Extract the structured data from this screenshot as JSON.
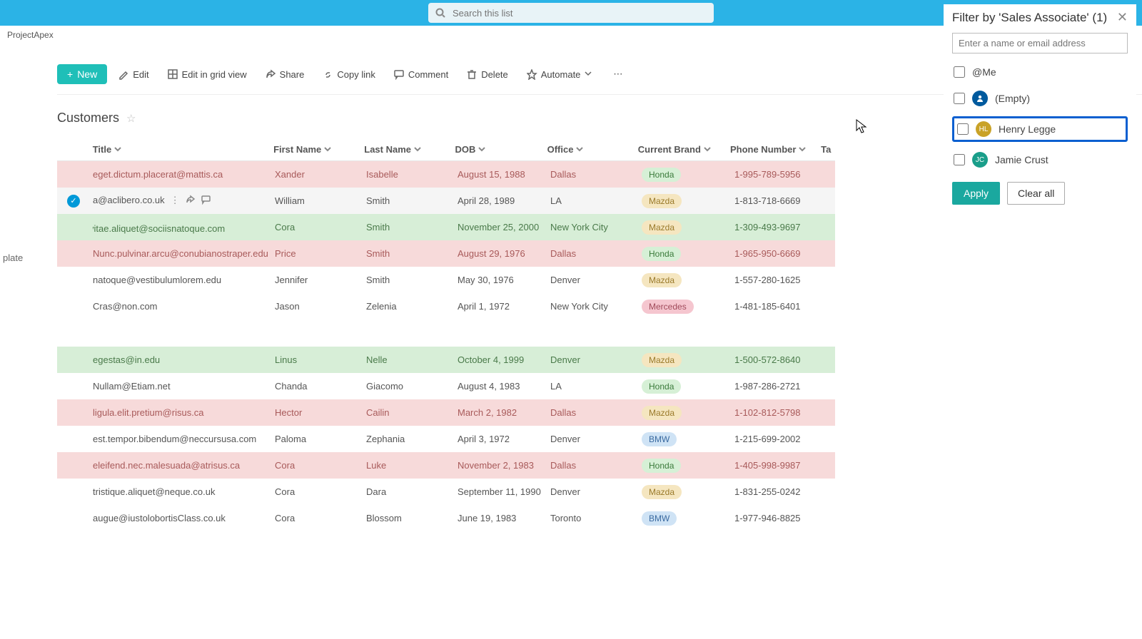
{
  "search": {
    "placeholder": "Search this list"
  },
  "breadcrumb": "ProjectApex",
  "sidebar_cut": "plate",
  "toolbar": {
    "new": "New",
    "edit": "Edit",
    "grid": "Edit in grid view",
    "share": "Share",
    "copy": "Copy link",
    "comment": "Comment",
    "delete": "Delete",
    "automate": "Automate"
  },
  "list": {
    "title": "Customers"
  },
  "columns": {
    "title": "Title",
    "first": "First Name",
    "last": "Last Name",
    "dob": "DOB",
    "office": "Office",
    "brand": "Current Brand",
    "phone": "Phone Number",
    "ta": "Ta"
  },
  "rows": [
    {
      "cls": "pink",
      "title": "eget.dictum.placerat@mattis.ca",
      "fn": "Xander",
      "ln": "Isabelle",
      "dob": "August 15, 1988",
      "off": "Dallas",
      "brand": "Honda",
      "phone": "1-995-789-5956"
    },
    {
      "cls": "sel",
      "title": "a@aclibero.co.uk",
      "fn": "William",
      "ln": "Smith",
      "dob": "April 28, 1989",
      "off": "LA",
      "brand": "Mazda",
      "phone": "1-813-718-6669",
      "selected": true,
      "dots": true
    },
    {
      "cls": "green",
      "title": "vitae.aliquet@sociisnatoque.com",
      "fn": "Cora",
      "ln": "Smith",
      "dob": "November 25, 2000",
      "off": "New York City",
      "brand": "Mazda",
      "phone": "1-309-493-9697",
      "chat": true
    },
    {
      "cls": "pink",
      "title": "Nunc.pulvinar.arcu@conubianostraper.edu",
      "fn": "Price",
      "ln": "Smith",
      "dob": "August 29, 1976",
      "off": "Dallas",
      "brand": "Honda",
      "phone": "1-965-950-6669"
    },
    {
      "cls": "white",
      "title": "natoque@vestibulumlorem.edu",
      "fn": "Jennifer",
      "ln": "Smith",
      "dob": "May 30, 1976",
      "off": "Denver",
      "brand": "Mazda",
      "phone": "1-557-280-1625"
    },
    {
      "cls": "white",
      "title": "Cras@non.com",
      "fn": "Jason",
      "ln": "Zelenia",
      "dob": "April 1, 1972",
      "off": "New York City",
      "brand": "Mercedes",
      "phone": "1-481-185-6401"
    },
    {
      "spacer": true
    },
    {
      "cls": "green",
      "title": "egestas@in.edu",
      "fn": "Linus",
      "ln": "Nelle",
      "dob": "October 4, 1999",
      "off": "Denver",
      "brand": "Mazda",
      "phone": "1-500-572-8640"
    },
    {
      "cls": "white",
      "title": "Nullam@Etiam.net",
      "fn": "Chanda",
      "ln": "Giacomo",
      "dob": "August 4, 1983",
      "off": "LA",
      "brand": "Honda",
      "phone": "1-987-286-2721"
    },
    {
      "cls": "pink",
      "title": "ligula.elit.pretium@risus.ca",
      "fn": "Hector",
      "ln": "Cailin",
      "dob": "March 2, 1982",
      "off": "Dallas",
      "brand": "Mazda",
      "phone": "1-102-812-5798"
    },
    {
      "cls": "white",
      "title": "est.tempor.bibendum@neccursusa.com",
      "fn": "Paloma",
      "ln": "Zephania",
      "dob": "April 3, 1972",
      "off": "Denver",
      "brand": "BMW",
      "phone": "1-215-699-2002"
    },
    {
      "cls": "pink",
      "title": "eleifend.nec.malesuada@atrisus.ca",
      "fn": "Cora",
      "ln": "Luke",
      "dob": "November 2, 1983",
      "off": "Dallas",
      "brand": "Honda",
      "phone": "1-405-998-9987"
    },
    {
      "cls": "white",
      "title": "tristique.aliquet@neque.co.uk",
      "fn": "Cora",
      "ln": "Dara",
      "dob": "September 11, 1990",
      "off": "Denver",
      "brand": "Mazda",
      "phone": "1-831-255-0242"
    },
    {
      "cls": "white",
      "title": "augue@iustolobortisClass.co.uk",
      "fn": "Cora",
      "ln": "Blossom",
      "dob": "June 19, 1983",
      "off": "Toronto",
      "brand": "BMW",
      "phone": "1-977-946-8825"
    }
  ],
  "filter": {
    "title": "Filter by 'Sales Associate' (1)",
    "input_placeholder": "Enter a name or email address",
    "opts": {
      "me": "@Me",
      "empty": "(Empty)",
      "henry": "Henry Legge",
      "jamie": "Jamie Crust"
    },
    "apply": "Apply",
    "clear": "Clear all"
  }
}
